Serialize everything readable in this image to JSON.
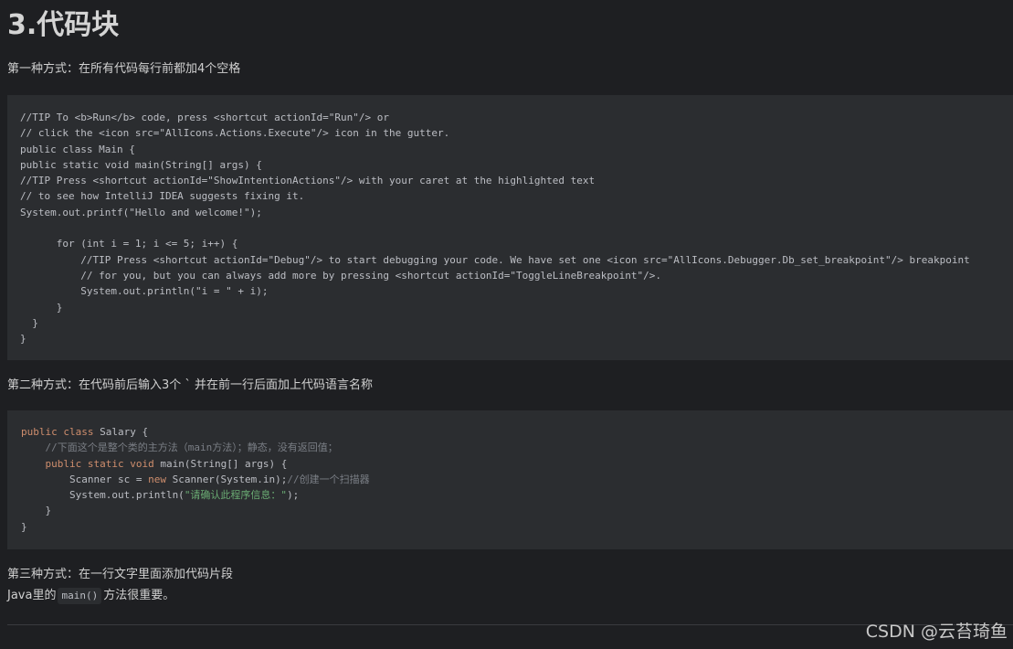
{
  "heading": "3.代码块",
  "method1": {
    "label": "第一种方式：在所有代码每行前都加4个空格",
    "code_lines": [
      "//TIP To <b>Run</b> code, press <shortcut actionId=\"Run\"/> or",
      "// click the <icon src=\"AllIcons.Actions.Execute\"/> icon in the gutter.",
      "public class Main {",
      "public static void main(String[] args) {",
      "//TIP Press <shortcut actionId=\"ShowIntentionActions\"/> with your caret at the highlighted text",
      "// to see how IntelliJ IDEA suggests fixing it.",
      "System.out.printf(\"Hello and welcome!\");",
      "",
      "      for (int i = 1; i <= 5; i++) {",
      "          //TIP Press <shortcut actionId=\"Debug\"/> to start debugging your code. We have set one <icon src=\"AllIcons.Debugger.Db_set_breakpoint\"/> breakpoint",
      "          // for you, but you can always add more by pressing <shortcut actionId=\"ToggleLineBreakpoint\"/>.",
      "          System.out.println(\"i = \" + i);",
      "      }",
      "  }",
      "}"
    ]
  },
  "method2": {
    "label": "第二种方式：在代码前后输入3个 ` 并在前一行后面加上代码语言名称",
    "code": {
      "kw_public_class": "public class",
      "class_name": " Salary {",
      "comment1": "    //下面这个是整个类的主方法（main方法）；静态，没有返回值；",
      "kw_public_static_void": "public static void",
      "method_sig": " main(String[] args) {",
      "scanner_prefix": "        Scanner sc = ",
      "kw_new": "new",
      "scanner_suffix": " Scanner(System.in);",
      "comment2": "//创建一个扫描器",
      "println_prefix": "        System.out.println(",
      "println_string": "\"请确认此程序信息：\"",
      "println_suffix": ");",
      "close_method": "    }",
      "close_class": "}"
    }
  },
  "method3": {
    "label": "第三种方式：在一行文字里面添加代码片段",
    "sentence_before": "Java里的",
    "inline_code": "main()",
    "sentence_after": "方法很重要。"
  },
  "watermark": "CSDN @云苔琦鱼"
}
